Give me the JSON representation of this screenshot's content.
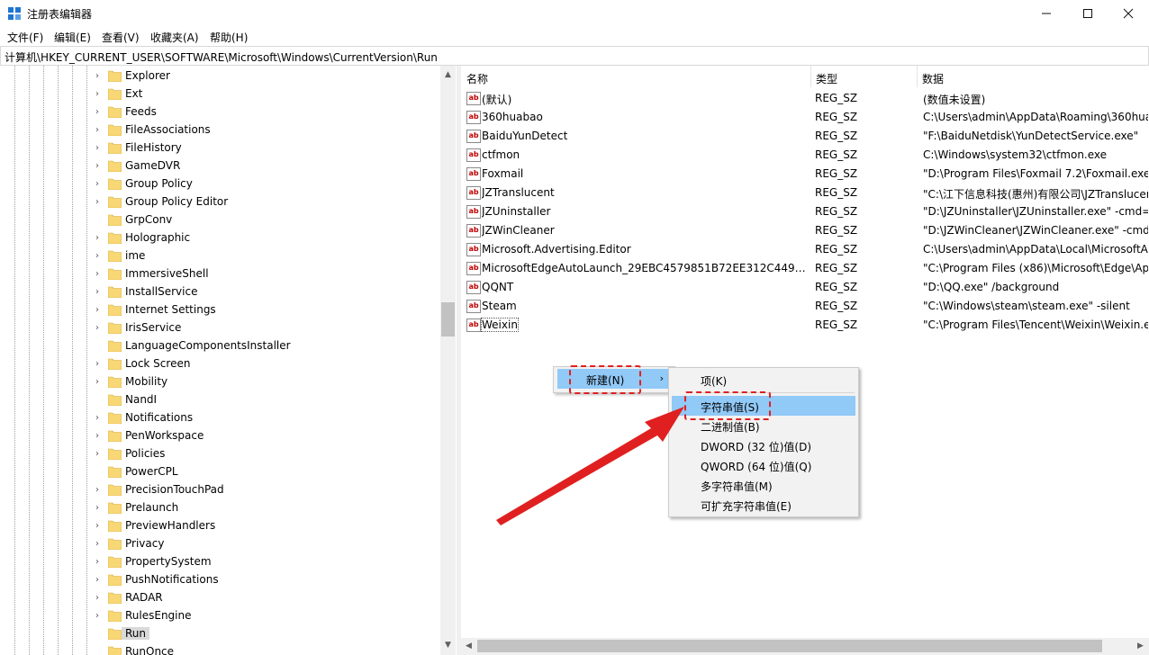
{
  "window": {
    "title": "注册表编辑器",
    "minimize_icon": "minimize-icon",
    "maximize_icon": "maximize-icon",
    "close_icon": "close-icon"
  },
  "menu": [
    "文件(F)",
    "编辑(E)",
    "查看(V)",
    "收藏夹(A)",
    "帮助(H)"
  ],
  "address": "计算机\\HKEY_CURRENT_USER\\SOFTWARE\\Microsoft\\Windows\\CurrentVersion\\Run",
  "tree": {
    "items": [
      {
        "label": "Explorer",
        "expandable": true
      },
      {
        "label": "Ext",
        "expandable": true
      },
      {
        "label": "Feeds",
        "expandable": true
      },
      {
        "label": "FileAssociations",
        "expandable": true
      },
      {
        "label": "FileHistory",
        "expandable": true
      },
      {
        "label": "GameDVR",
        "expandable": true
      },
      {
        "label": "Group Policy",
        "expandable": true
      },
      {
        "label": "Group Policy Editor",
        "expandable": true
      },
      {
        "label": "GrpConv",
        "expandable": false
      },
      {
        "label": "Holographic",
        "expandable": true
      },
      {
        "label": "ime",
        "expandable": true
      },
      {
        "label": "ImmersiveShell",
        "expandable": true
      },
      {
        "label": "InstallService",
        "expandable": true
      },
      {
        "label": "Internet Settings",
        "expandable": true
      },
      {
        "label": "IrisService",
        "expandable": true
      },
      {
        "label": "LanguageComponentsInstaller",
        "expandable": false
      },
      {
        "label": "Lock Screen",
        "expandable": true
      },
      {
        "label": "Mobility",
        "expandable": true
      },
      {
        "label": "NandI",
        "expandable": false
      },
      {
        "label": "Notifications",
        "expandable": true
      },
      {
        "label": "PenWorkspace",
        "expandable": true
      },
      {
        "label": "Policies",
        "expandable": true
      },
      {
        "label": "PowerCPL",
        "expandable": false
      },
      {
        "label": "PrecisionTouchPad",
        "expandable": true
      },
      {
        "label": "Prelaunch",
        "expandable": true
      },
      {
        "label": "PreviewHandlers",
        "expandable": true
      },
      {
        "label": "Privacy",
        "expandable": true
      },
      {
        "label": "PropertySystem",
        "expandable": true
      },
      {
        "label": "PushNotifications",
        "expandable": true
      },
      {
        "label": "RADAR",
        "expandable": true
      },
      {
        "label": "RulesEngine",
        "expandable": true
      },
      {
        "label": "Run",
        "expandable": false,
        "selected": true
      },
      {
        "label": "RunOnce",
        "expandable": false
      }
    ]
  },
  "values": {
    "columns": [
      "名称",
      "类型",
      "数据"
    ],
    "rows": [
      {
        "name": "(默认)",
        "type": "REG_SZ",
        "data": "(数值未设置)"
      },
      {
        "name": "360huabao",
        "type": "REG_SZ",
        "data": "C:\\Users\\admin\\AppData\\Roaming\\360hua"
      },
      {
        "name": "BaiduYunDetect",
        "type": "REG_SZ",
        "data": "\"F:\\BaiduNetdisk\\YunDetectService.exe\""
      },
      {
        "name": "ctfmon",
        "type": "REG_SZ",
        "data": "C:\\Windows\\system32\\ctfmon.exe"
      },
      {
        "name": "Foxmail",
        "type": "REG_SZ",
        "data": "\"D:\\Program Files\\Foxmail 7.2\\Foxmail.exe\""
      },
      {
        "name": "JZTranslucent",
        "type": "REG_SZ",
        "data": "\"C:\\江下信息科技(惠州)有限公司\\JZTranslucer"
      },
      {
        "name": "JZUninstaller",
        "type": "REG_SZ",
        "data": "\"D:\\JZUninstaller\\JZUninstaller.exe\" -cmd=h"
      },
      {
        "name": "JZWinCleaner",
        "type": "REG_SZ",
        "data": "\"D:\\JZWinCleaner\\JZWinCleaner.exe\" -cmd="
      },
      {
        "name": "Microsoft.Advertising.Editor",
        "type": "REG_SZ",
        "data": "C:\\Users\\admin\\AppData\\Local\\MicrosoftA"
      },
      {
        "name": "MicrosoftEdgeAutoLaunch_29EBC4579851B72EE312C449CF8...",
        "type": "REG_SZ",
        "data": "\"C:\\Program Files (x86)\\Microsoft\\Edge\\Ap"
      },
      {
        "name": "QQNT",
        "type": "REG_SZ",
        "data": "\"D:\\QQ.exe\" /background"
      },
      {
        "name": "Steam",
        "type": "REG_SZ",
        "data": "\"C:\\Windows\\steam\\steam.exe\" -silent"
      },
      {
        "name": "Weixin",
        "type": "REG_SZ",
        "data": "\"C:\\Program Files\\Tencent\\Weixin\\Weixin.e"
      }
    ]
  },
  "context_menu": {
    "new_label": "新建(N)",
    "submenu": [
      "项(K)",
      "字符串值(S)",
      "二进制值(B)",
      "DWORD (32 位)值(D)",
      "QWORD (64 位)值(Q)",
      "多字符串值(M)",
      "可扩充字符串值(E)"
    ],
    "highlighted_index": 1
  },
  "colors": {
    "highlight": "#91c9f7",
    "annotation": "#e02020",
    "folder": "#f8d775"
  }
}
